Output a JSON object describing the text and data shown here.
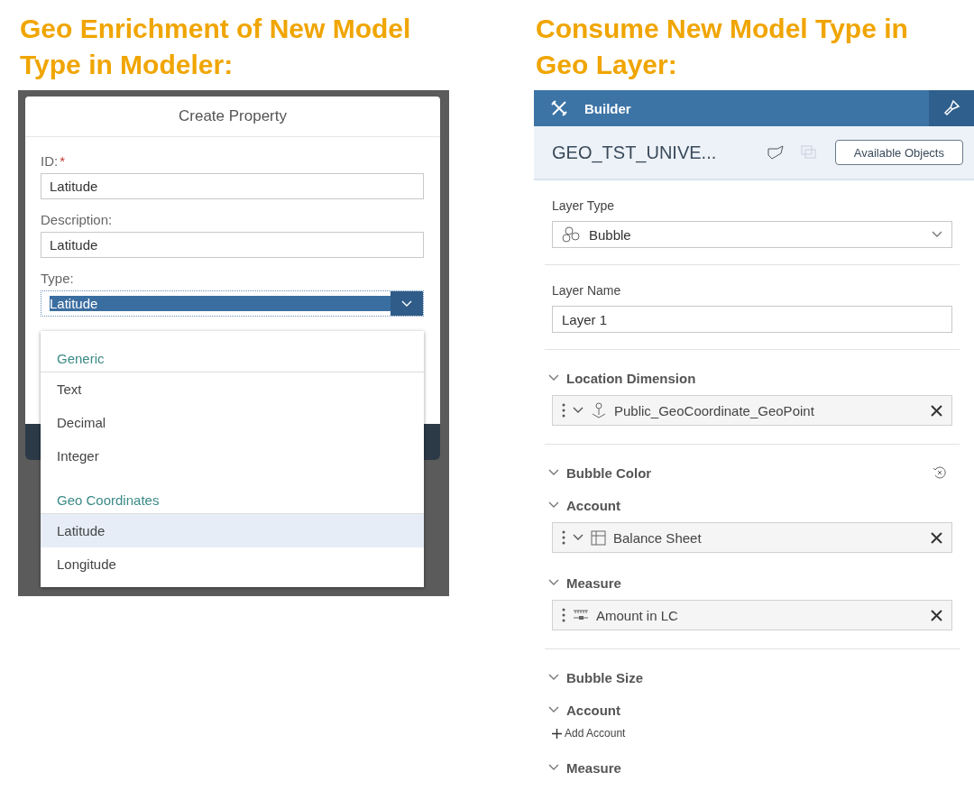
{
  "left": {
    "heading": "Geo Enrichment of New Model Type in Modeler:",
    "dialog": {
      "title": "Create Property",
      "fields": [
        {
          "label": "ID:",
          "required_mark": "*",
          "value": "Latitude"
        },
        {
          "label": "Description:",
          "value": "Latitude"
        }
      ],
      "type_field": {
        "label": "Type:",
        "value": "Latitude"
      },
      "dropdown": {
        "groups": [
          {
            "label": "Generic",
            "items": [
              {
                "label": "Text",
                "selected": false
              },
              {
                "label": "Decimal",
                "selected": false
              },
              {
                "label": "Integer",
                "selected": false
              }
            ]
          },
          {
            "label": "Geo Coordinates",
            "items": [
              {
                "label": "Latitude",
                "selected": true
              },
              {
                "label": "Longitude",
                "selected": false
              }
            ]
          }
        ]
      }
    }
  },
  "right": {
    "heading": "Consume New Model Type in Geo Layer:",
    "toolbar": {
      "title": "Builder"
    },
    "header": {
      "title": "GEO_TST_UNIVE...",
      "button": "Available Objects"
    },
    "groups": [
      {
        "rows": [
          {
            "kind": "select",
            "label": "Layer Type",
            "value": "Bubble"
          }
        ]
      },
      {
        "rows": [
          {
            "kind": "input",
            "label": "Layer Name",
            "value": "Layer 1"
          }
        ]
      },
      {
        "rows": [
          {
            "kind": "heading",
            "label": "Location Dimension",
            "expanded": true
          },
          {
            "kind": "dimension",
            "label": "Public_GeoCoordinate_GeoPoint"
          }
        ]
      },
      {
        "rows": [
          {
            "kind": "heading",
            "label": "Bubble Color",
            "expanded": true,
            "reset": true
          },
          {
            "kind": "heading",
            "label": "Account",
            "expanded": true
          },
          {
            "kind": "account",
            "label": "Balance Sheet"
          },
          {
            "kind": "heading",
            "label": "Measure",
            "expanded": true
          },
          {
            "kind": "measure",
            "label": "Amount in LC"
          }
        ]
      },
      {
        "rows": [
          {
            "kind": "heading",
            "label": "Bubble Size",
            "expanded": true
          },
          {
            "kind": "heading",
            "label": "Account",
            "expanded": true
          },
          {
            "kind": "add",
            "label": "Add Account"
          },
          {
            "kind": "heading",
            "label": "Measure",
            "expanded": true
          }
        ]
      }
    ]
  }
}
